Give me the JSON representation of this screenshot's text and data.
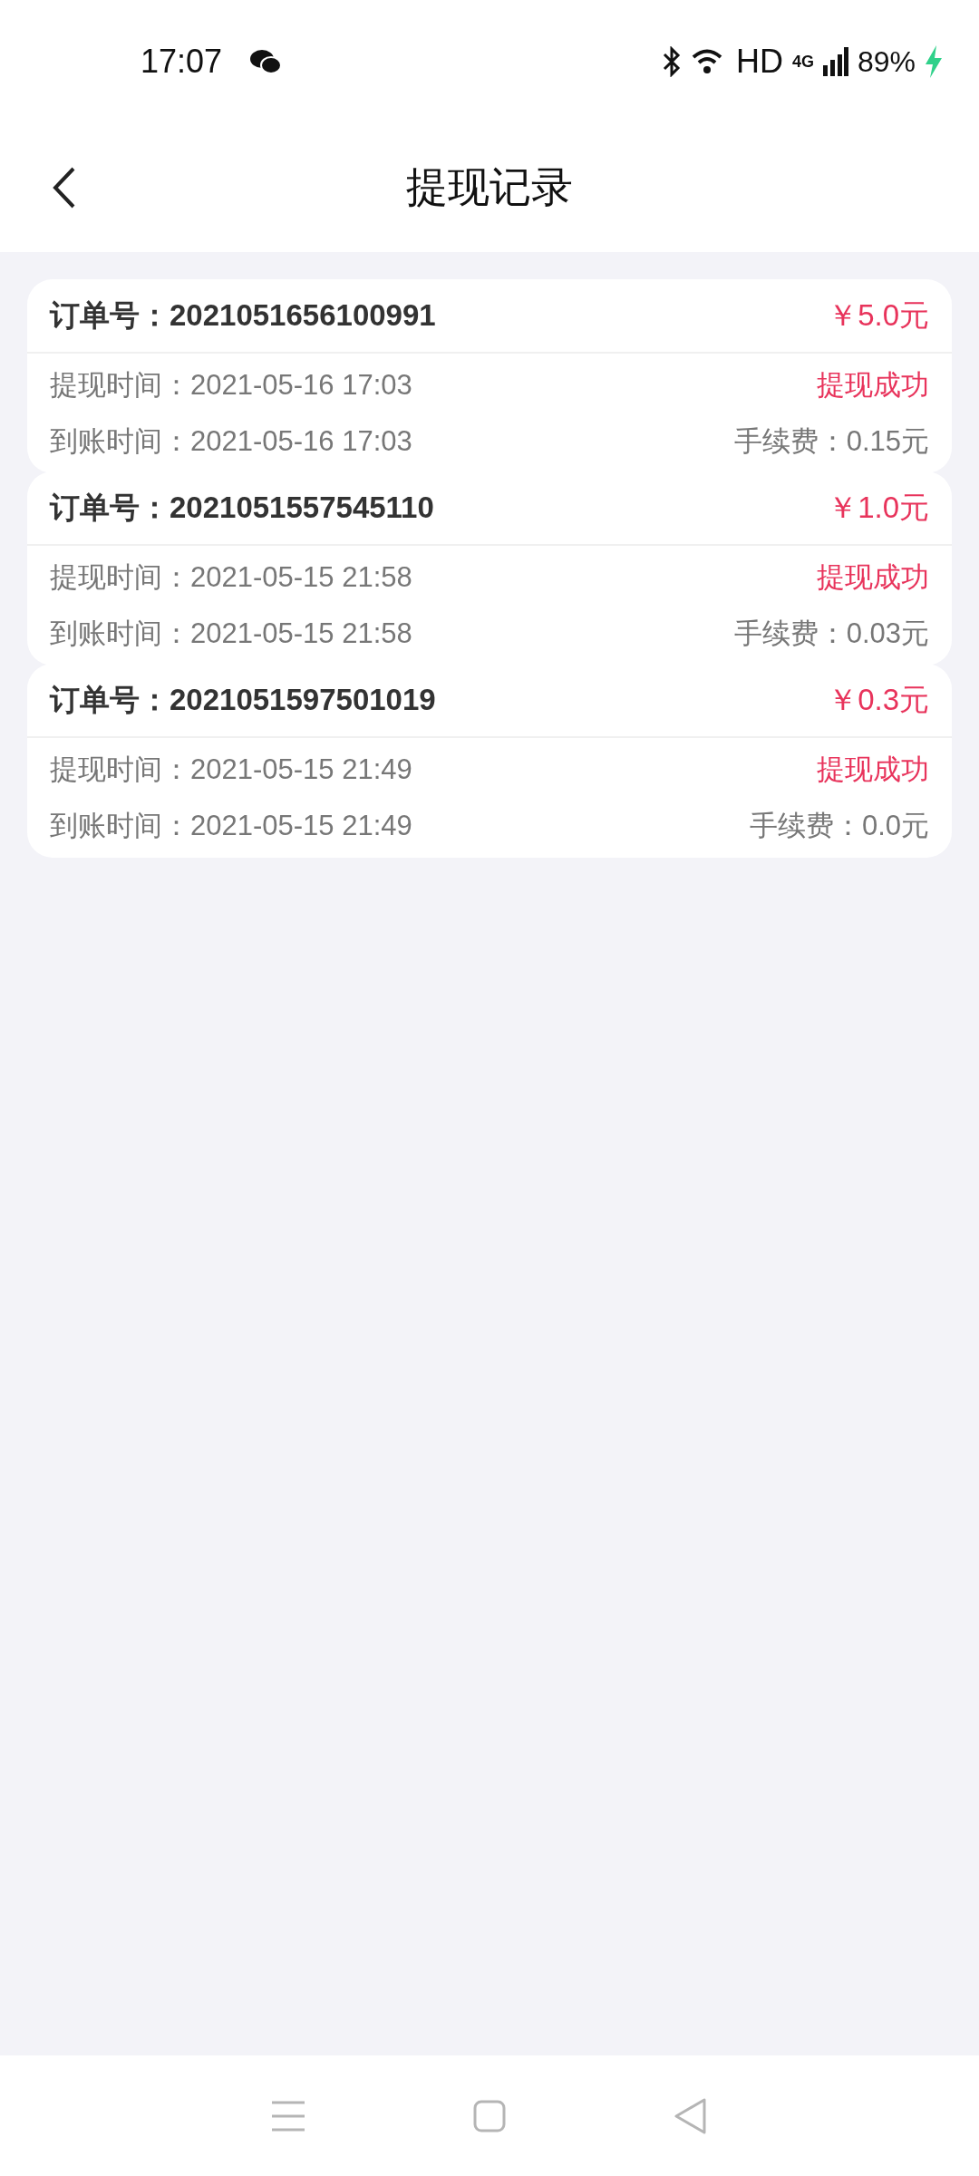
{
  "status_bar": {
    "time": "17:07",
    "network": "HD",
    "cellular": "4G",
    "battery": "89%"
  },
  "header": {
    "title": "提现记录"
  },
  "records": [
    {
      "order": "订单号：2021051656100991",
      "amount": "￥5.0元",
      "apply_time": "提现时间：2021-05-16 17:03",
      "status": "提现成功",
      "arrive_time": "到账时间：2021-05-16 17:03",
      "fee": "手续费：0.15元"
    },
    {
      "order": "订单号：2021051557545110",
      "amount": "￥1.0元",
      "apply_time": "提现时间：2021-05-15 21:58",
      "status": "提现成功",
      "arrive_time": "到账时间：2021-05-15 21:58",
      "fee": "手续费：0.03元"
    },
    {
      "order": "订单号：2021051597501019",
      "amount": "￥0.3元",
      "apply_time": "提现时间：2021-05-15 21:49",
      "status": "提现成功",
      "arrive_time": "到账时间：2021-05-15 21:49",
      "fee": "手续费：0.0元"
    }
  ]
}
